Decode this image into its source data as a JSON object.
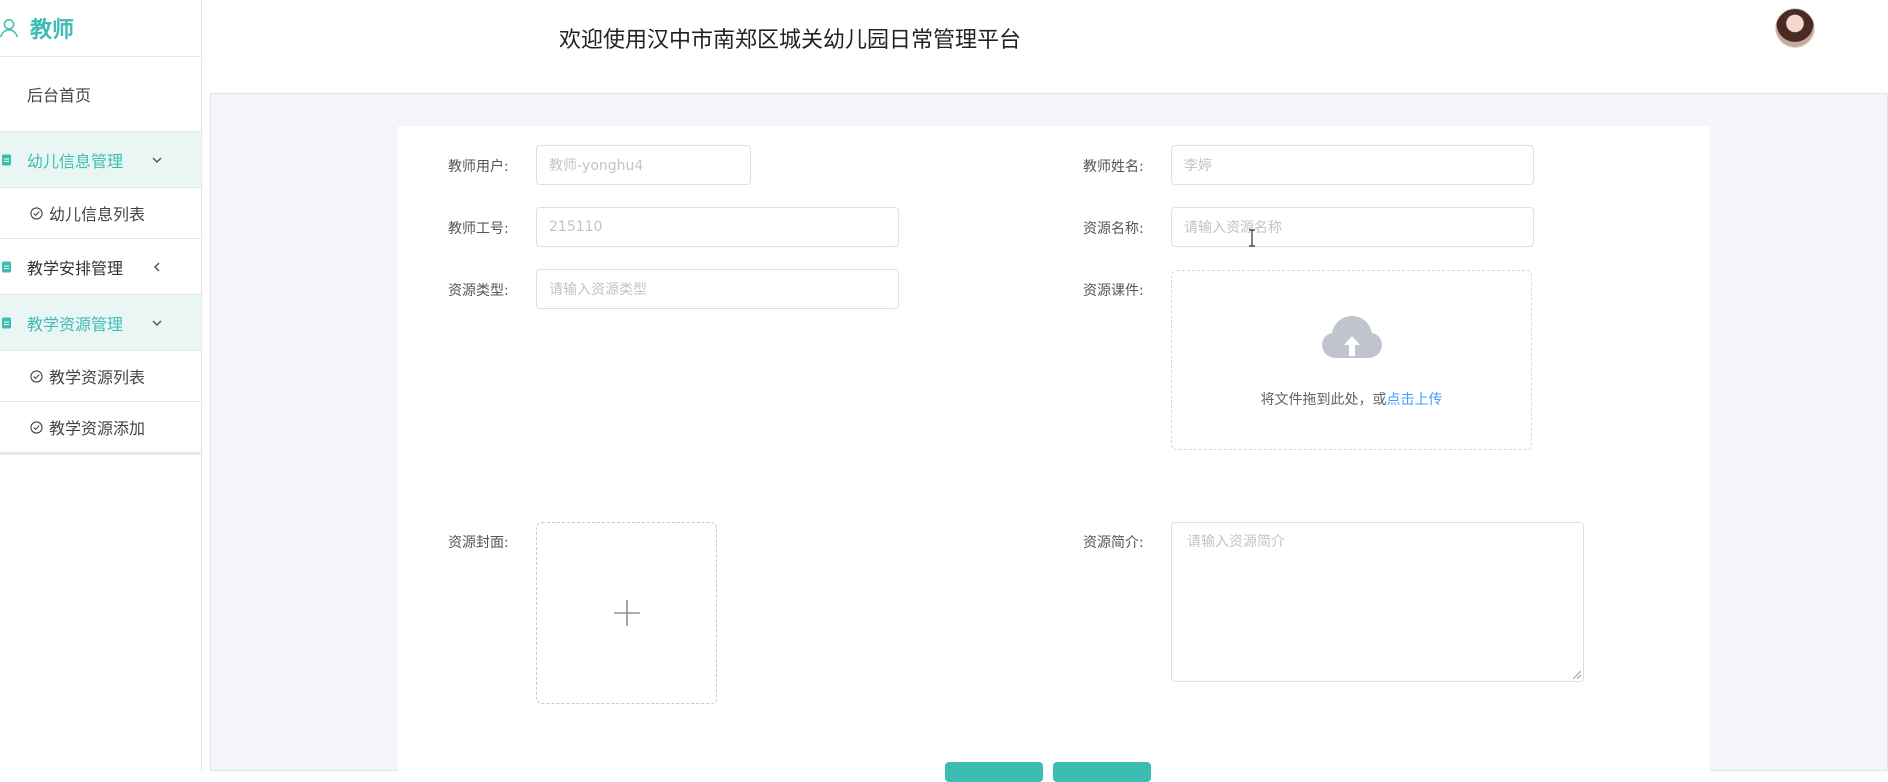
{
  "sidebar": {
    "brand": "教师",
    "home": "后台首页",
    "groups": [
      {
        "label": "幼儿信息管理",
        "sub": [
          "幼儿信息列表"
        ]
      },
      {
        "label": "教学安排管理",
        "sub": []
      },
      {
        "label": "教学资源管理",
        "sub": [
          "教学资源列表",
          "教学资源添加"
        ]
      }
    ]
  },
  "header": {
    "title": "欢迎使用汉中市南郑区城关幼儿园日常管理平台"
  },
  "form": {
    "teacher_user": {
      "label": "教师用户:",
      "value": "教师-yonghu4"
    },
    "teacher_name": {
      "label": "教师姓名:",
      "value": "李婷"
    },
    "teacher_no": {
      "label": "教师工号:",
      "value": "215110"
    },
    "resource_name": {
      "label": "资源名称:",
      "placeholder": "请输入资源名称"
    },
    "resource_type": {
      "label": "资源类型:",
      "placeholder": "请输入资源类型"
    },
    "resource_file": {
      "label": "资源课件:",
      "drag_text": "将文件拖到此处，或",
      "link_text": "点击上传"
    },
    "resource_cover": {
      "label": "资源封面:"
    },
    "resource_intro": {
      "label": "资源简介:",
      "placeholder": "请输入资源简介"
    }
  },
  "colors": {
    "accent": "#3dbdb2",
    "link": "#409eff",
    "active_bg": "#e9f6f3"
  }
}
